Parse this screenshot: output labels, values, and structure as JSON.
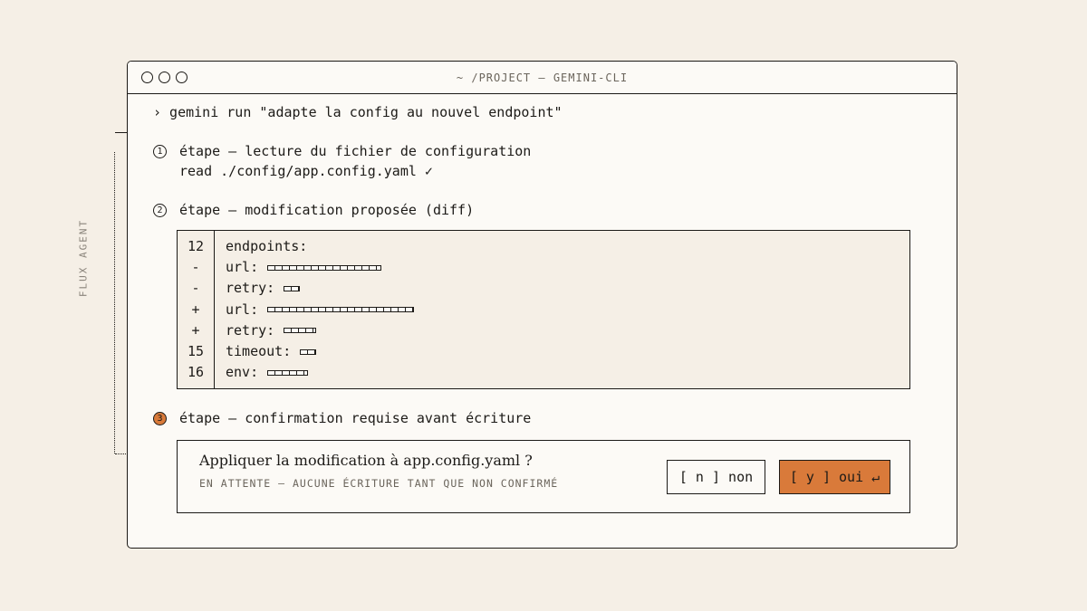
{
  "side_label": "FLUX AGENT",
  "window": {
    "title": "~ /PROJECT — GEMINI-CLI",
    "command": "› gemini run \"adapte la config au nouvel endpoint\""
  },
  "steps": [
    {
      "number": "1",
      "label": "étape — lecture du fichier de configuration",
      "detail": "read ./config/app.config.yaml ✓"
    },
    {
      "number": "2",
      "label": "étape — modification proposée (diff)"
    },
    {
      "number": "3",
      "label": "étape — confirmation requise avant écriture"
    }
  ],
  "diff": [
    {
      "line": "12",
      "code": "endpoints:",
      "blocks": 0
    },
    {
      "line": "-",
      "code": "url:",
      "blocks": 14
    },
    {
      "line": "-",
      "code": "retry:",
      "blocks": 2
    },
    {
      "line": "+",
      "code": "url:",
      "blocks": 18
    },
    {
      "line": "+",
      "code": "retry:",
      "blocks": 4
    },
    {
      "line": "15",
      "code": "timeout:",
      "blocks": 2
    },
    {
      "line": "16",
      "code": "env:",
      "blocks": 5
    }
  ],
  "confirm": {
    "question": "Appliquer la modification à app.config.yaml ?",
    "hint": "EN ATTENTE — AUCUNE ÉCRITURE TANT QUE NON CONFIRMÉ",
    "no_label": "[ n ] non",
    "yes_label": "[ y ] oui ↵"
  },
  "colors": {
    "accent": "#d97a3a",
    "background": "#f5efe6",
    "panel": "#fcfaf6",
    "ink": "#1c1a17"
  }
}
